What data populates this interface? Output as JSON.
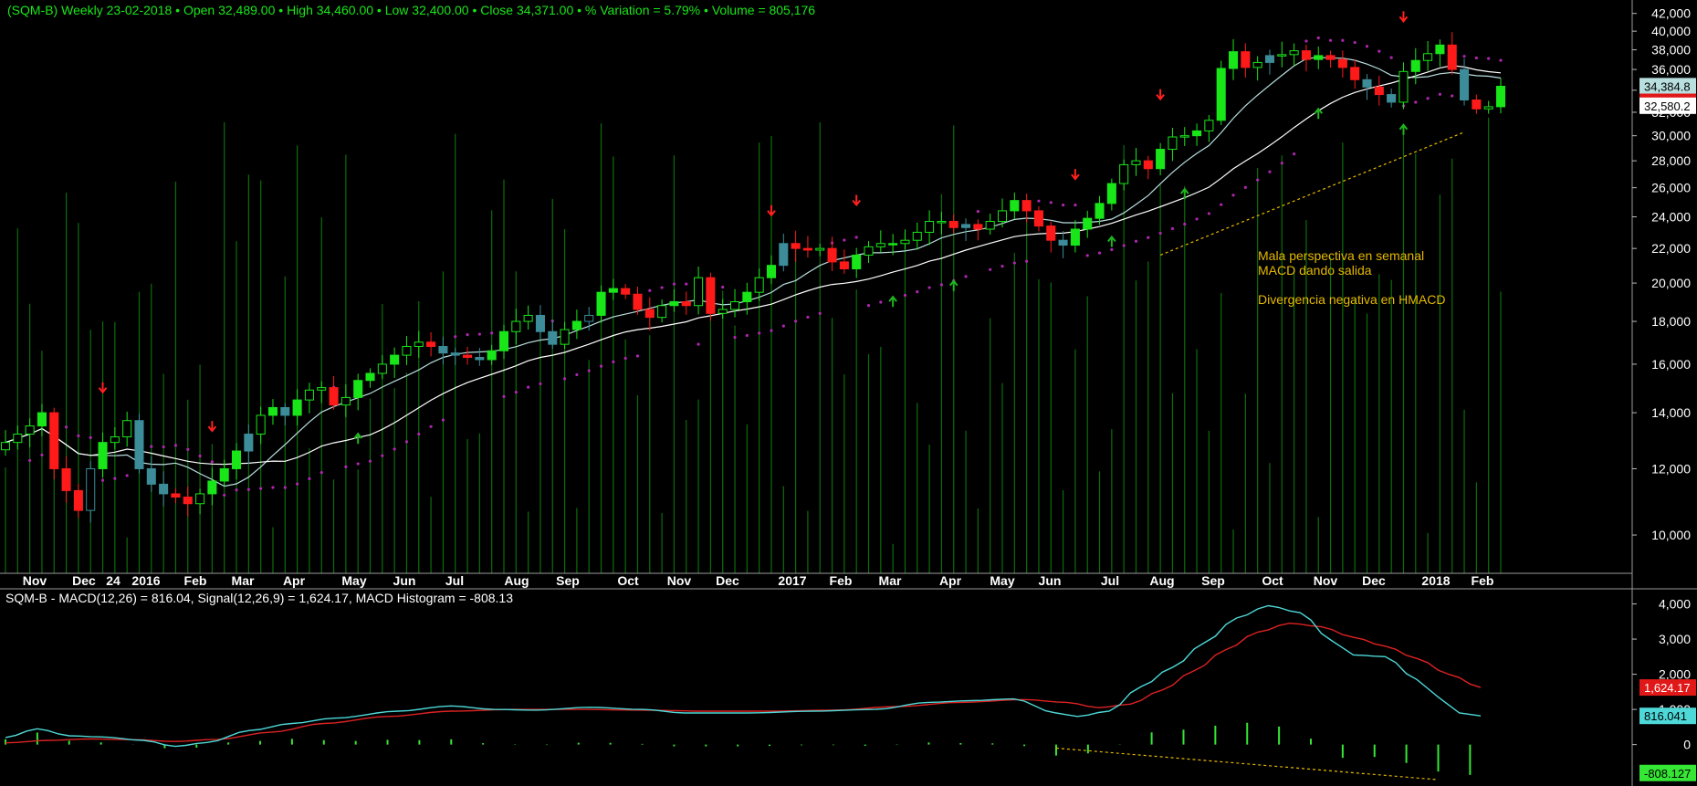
{
  "header": {
    "symbol": "(SQM-B) Weekly",
    "date": "23-02-2018",
    "open": "Open 32,489.00",
    "high": "High 34,460.00",
    "low": "Low 32,400.00",
    "close": "Close 34,371.00",
    "variation": "% Variation = 5.79%",
    "volume": "Volume = 805,176",
    "separator": "•"
  },
  "annotations": {
    "line1": "Mala perspectiva en semanal",
    "line2": "MACD dando salida",
    "line3": "Divergencia negativa en HMACD"
  },
  "colors": {
    "background": "#000000",
    "up_candle": "#19e619",
    "down_candle": "#ff1a1a",
    "neutral_candle": "#3c8c99",
    "volume": "#0b6e0b",
    "ma_fast": "#b8dede",
    "ma_slow": "#ffffff",
    "sar": "#b026b0",
    "macd": "#4ed8d8",
    "signal": "#dd2222",
    "histogram": "#35e635",
    "trendline": "#e6b800",
    "annotation_text": "#e6b800",
    "axis_text": "#ffffff",
    "header_text": "#19e619"
  },
  "chart_data": [
    {
      "type": "candlestick",
      "title": "(SQM-B) Weekly",
      "scale": "log",
      "ylim": [
        9000,
        42500
      ],
      "y_ticks": [
        10000,
        12000,
        14000,
        16000,
        18000,
        20000,
        22000,
        24000,
        26000,
        28000,
        30000,
        32000,
        34000,
        36000,
        38000,
        40000,
        42000
      ],
      "x_labels": [
        "Nov",
        "Dec",
        "24",
        "2016",
        "Feb",
        "Mar",
        "Apr",
        "May",
        "Jun",
        "Jul",
        "Aug",
        "Sep",
        "Oct",
        "Nov",
        "Dec",
        "2017",
        "Feb",
        "Mar",
        "Apr",
        "May",
        "Jun",
        "Jul",
        "Aug",
        "Sep",
        "Oct",
        "Nov",
        "Dec",
        "2018",
        "Feb"
      ],
      "last_price_labels": [
        "34,384.8",
        "34,371",
        "32,580.2"
      ],
      "closes": [
        12900,
        13200,
        13500,
        14000,
        12000,
        11300,
        10700,
        12000,
        12900,
        13100,
        13700,
        12000,
        11500,
        11200,
        11100,
        10900,
        11200,
        11600,
        12000,
        12600,
        13200,
        13900,
        14200,
        13900,
        14500,
        14900,
        15000,
        14300,
        14600,
        15300,
        15600,
        16000,
        16400,
        16800,
        17000,
        16800,
        16500,
        16400,
        16300,
        16200,
        16600,
        17500,
        18000,
        18300,
        17500,
        16900,
        17600,
        18000,
        18300,
        19500,
        19700,
        19400,
        18600,
        18200,
        18800,
        19000,
        18800,
        20300,
        18400,
        18600,
        19000,
        19500,
        20300,
        21000,
        22300,
        22000,
        21900,
        22000,
        21200,
        20800,
        21600,
        22100,
        22300,
        22300,
        22500,
        23000,
        23700,
        23700,
        23300,
        23500,
        23200,
        23700,
        24400,
        25100,
        24400,
        23400,
        22500,
        22200,
        23200,
        23900,
        24900,
        26300,
        27700,
        28000,
        27400,
        28900,
        29900,
        30000,
        30400,
        31300,
        36100,
        37800,
        36200,
        36700,
        37400,
        37500,
        37900,
        37000,
        37400,
        37000,
        36200,
        35000,
        34300,
        33600,
        32900,
        35800,
        36900,
        37600,
        38500,
        36000,
        33100,
        32300,
        32489,
        34371
      ],
      "ma_fast_last": 34384.8,
      "ma_slow_last": 32580.2,
      "sell_signal_weeks": [
        8,
        17,
        63,
        70,
        88,
        95,
        115,
        128,
        132
      ],
      "buy_signal_weeks": [
        29,
        73,
        78,
        91,
        97,
        108,
        115,
        130
      ]
    },
    {
      "type": "line",
      "title": "SQM-B - MACD(12,26) = 816.04, Signal(12,26,9) = 1,624.17, MACD Histogram = -808.13",
      "series": [
        {
          "name": "MACD(12,26)",
          "last": 816.04
        },
        {
          "name": "Signal(12,26,9)",
          "last": 1624.17
        },
        {
          "name": "MACD Histogram",
          "last": -808.13
        }
      ],
      "ylim": [
        -1100,
        4300
      ],
      "y_ticks": [
        0,
        1000,
        2000,
        3000,
        4000
      ],
      "y_tick_labels": [
        "0",
        "1,000",
        "2,000",
        "3,000",
        "4,000"
      ],
      "last_value_labels": [
        "1,624.17",
        "816.041",
        "-808.127"
      ],
      "macd_anchors": [
        [
          0,
          200
        ],
        [
          3,
          450
        ],
        [
          6,
          250
        ],
        [
          9,
          220
        ],
        [
          13,
          120
        ],
        [
          16,
          -50
        ],
        [
          19,
          60
        ],
        [
          23,
          400
        ],
        [
          27,
          600
        ],
        [
          31,
          750
        ],
        [
          37,
          950
        ],
        [
          42,
          1100
        ],
        [
          46,
          1000
        ],
        [
          50,
          980
        ],
        [
          55,
          1060
        ],
        [
          60,
          1000
        ],
        [
          64,
          900
        ],
        [
          70,
          900
        ],
        [
          76,
          950
        ],
        [
          82,
          1000
        ],
        [
          87,
          1200
        ],
        [
          91,
          1250
        ],
        [
          95,
          1300
        ],
        [
          99,
          900
        ],
        [
          101,
          800
        ],
        [
          104,
          950
        ],
        [
          107,
          1650
        ],
        [
          110,
          2200
        ],
        [
          113,
          2900
        ],
        [
          116,
          3600
        ],
        [
          119,
          3950
        ],
        [
          122,
          3750
        ],
        [
          125,
          2950
        ],
        [
          127,
          2550
        ],
        [
          130,
          2500
        ],
        [
          133,
          1850
        ],
        [
          135,
          1350
        ],
        [
          137,
          900
        ],
        [
          139,
          816
        ]
      ],
      "signal_anchors": [
        [
          0,
          50
        ],
        [
          4,
          120
        ],
        [
          8,
          160
        ],
        [
          12,
          140
        ],
        [
          16,
          90
        ],
        [
          20,
          150
        ],
        [
          25,
          350
        ],
        [
          30,
          600
        ],
        [
          36,
          800
        ],
        [
          42,
          950
        ],
        [
          48,
          1000
        ],
        [
          54,
          1000
        ],
        [
          60,
          980
        ],
        [
          66,
          950
        ],
        [
          72,
          950
        ],
        [
          78,
          980
        ],
        [
          84,
          1080
        ],
        [
          90,
          1200
        ],
        [
          96,
          1280
        ],
        [
          100,
          1200
        ],
        [
          103,
          1050
        ],
        [
          106,
          1150
        ],
        [
          109,
          1550
        ],
        [
          112,
          2100
        ],
        [
          115,
          2700
        ],
        [
          118,
          3200
        ],
        [
          121,
          3450
        ],
        [
          124,
          3350
        ],
        [
          127,
          3050
        ],
        [
          130,
          2800
        ],
        [
          133,
          2450
        ],
        [
          136,
          2000
        ],
        [
          139,
          1624
        ]
      ]
    }
  ]
}
